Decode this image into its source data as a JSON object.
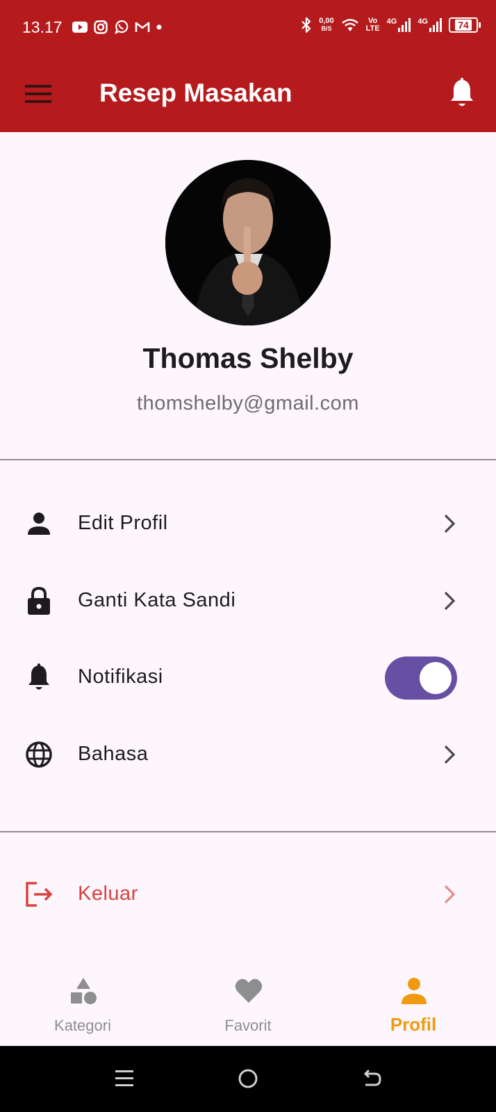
{
  "status_bar": {
    "time": "13.17",
    "net_speed_top": "0,00",
    "net_speed_bottom": "B/S",
    "volte_top": "Vo",
    "volte_bottom": "LTE",
    "signal1": "4G",
    "signal2": "4G",
    "battery": "74"
  },
  "app_bar": {
    "title": "Resep Masakan"
  },
  "profile": {
    "name": "Thomas Shelby",
    "email": "thomshelby@gmail.com"
  },
  "settings": {
    "edit_profile": "Edit Profil",
    "change_password": "Ganti Kata Sandi",
    "notifications": "Notifikasi",
    "notifications_enabled": true,
    "language": "Bahasa"
  },
  "logout": {
    "label": "Keluar"
  },
  "bottom_nav": {
    "items": [
      {
        "label": "Kategori",
        "icon": "category-icon",
        "active": false
      },
      {
        "label": "Favorit",
        "icon": "heart-icon",
        "active": false
      },
      {
        "label": "Profil",
        "icon": "person-icon",
        "active": true
      }
    ]
  },
  "colors": {
    "primary": "#b51b1d",
    "accent": "#ef9a10",
    "toggle": "#6750a4",
    "logout": "#d9423d"
  }
}
